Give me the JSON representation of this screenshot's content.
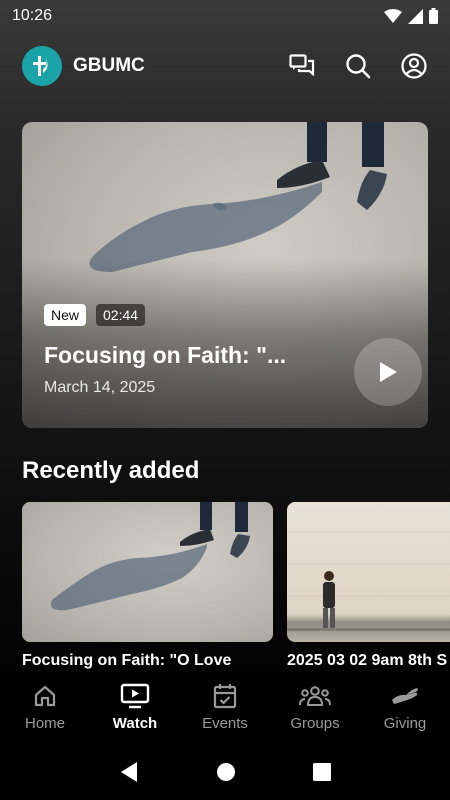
{
  "status_bar": {
    "time": "10:26"
  },
  "header": {
    "app_name": "GBUMC"
  },
  "hero": {
    "badge_new": "New",
    "duration": "02:44",
    "title": "Focusing on Faith: \"...",
    "date": "March 14, 2025"
  },
  "recent": {
    "heading": "Recently added",
    "items": [
      {
        "title": "Focusing on Faith: \"O Love"
      },
      {
        "title": "2025 03 02 9am 8th S"
      }
    ]
  },
  "nav": {
    "items": [
      {
        "label": "Home",
        "icon": "home-icon"
      },
      {
        "label": "Watch",
        "icon": "tv-icon",
        "active": true
      },
      {
        "label": "Events",
        "icon": "calendar-icon"
      },
      {
        "label": "Groups",
        "icon": "groups-icon"
      },
      {
        "label": "Giving",
        "icon": "hand-icon"
      }
    ]
  },
  "colors": {
    "brand": "#1aa4a9",
    "inactive": "#9a9a9a"
  }
}
